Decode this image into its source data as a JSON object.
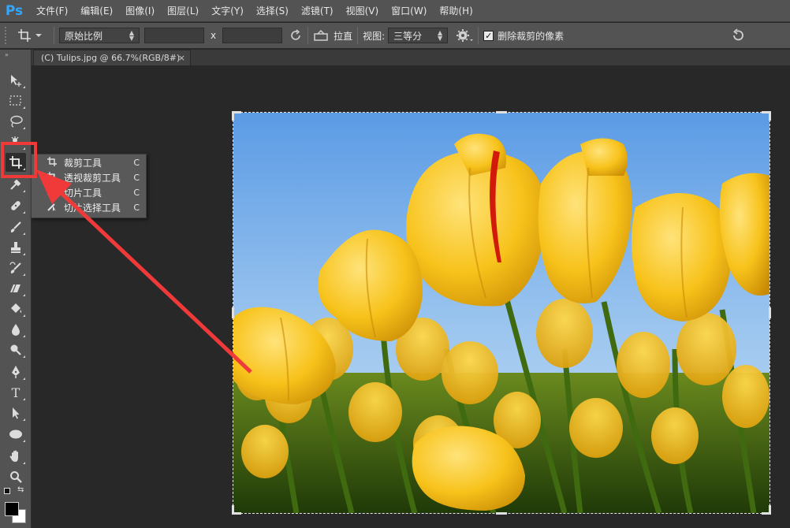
{
  "app": {
    "logo": "Ps"
  },
  "menu": [
    "文件(F)",
    "编辑(E)",
    "图像(I)",
    "图层(L)",
    "文字(Y)",
    "选择(S)",
    "滤镜(T)",
    "视图(V)",
    "窗口(W)",
    "帮助(H)"
  ],
  "options": {
    "ratio_select": "原始比例",
    "x_sep": "x",
    "straighten_label": "拉直",
    "view_label": "视图:",
    "view_select": "三等分",
    "delete_cropped_label": "删除裁剪的像素",
    "delete_cropped_checked": true
  },
  "document": {
    "tab_title": "(C) Tulips.jpg @ 66.7%(RGB/8#)",
    "close": "×"
  },
  "tools": [
    {
      "name": "move-tool",
      "icon": "move-icon"
    },
    {
      "name": "marquee-tool",
      "icon": "rect-marquee-icon"
    },
    {
      "name": "lasso-tool",
      "icon": "lasso-icon"
    },
    {
      "name": "quick-select-tool",
      "icon": "quick-select-icon"
    },
    {
      "name": "crop-tool",
      "icon": "crop-icon",
      "active": true
    },
    {
      "name": "eyedropper-tool",
      "icon": "eyedropper-icon"
    },
    {
      "name": "healing-tool",
      "icon": "bandage-icon"
    },
    {
      "name": "brush-tool",
      "icon": "brush-icon"
    },
    {
      "name": "stamp-tool",
      "icon": "stamp-icon"
    },
    {
      "name": "history-brush-tool",
      "icon": "history-brush-icon"
    },
    {
      "name": "eraser-tool",
      "icon": "eraser-icon"
    },
    {
      "name": "paint-bucket-tool",
      "icon": "bucket-icon"
    },
    {
      "name": "blur-tool",
      "icon": "drop-icon"
    },
    {
      "name": "dodge-tool",
      "icon": "dodge-icon"
    },
    {
      "name": "pen-tool",
      "icon": "pen-icon"
    },
    {
      "name": "type-tool",
      "icon": "type-icon",
      "glyph": "T"
    },
    {
      "name": "path-select-tool",
      "icon": "arrow-icon"
    },
    {
      "name": "shape-tool",
      "icon": "ellipse-icon"
    },
    {
      "name": "hand-tool",
      "icon": "hand-icon"
    },
    {
      "name": "zoom-tool",
      "icon": "zoom-icon"
    }
  ],
  "flyout": [
    {
      "label": "裁剪工具",
      "key": "C",
      "icon": "crop-icon"
    },
    {
      "label": "透视裁剪工具",
      "key": "C",
      "icon": "perspective-crop-icon"
    },
    {
      "label": "切片工具",
      "key": "C",
      "icon": "slice-icon"
    },
    {
      "label": "切片选择工具",
      "key": "C",
      "icon": "slice-select-icon"
    }
  ],
  "colors": {
    "ui_bg": "#535353",
    "canvas_bg": "#282828",
    "highlight": "#f03a3a",
    "logo": "#31a8ff"
  }
}
